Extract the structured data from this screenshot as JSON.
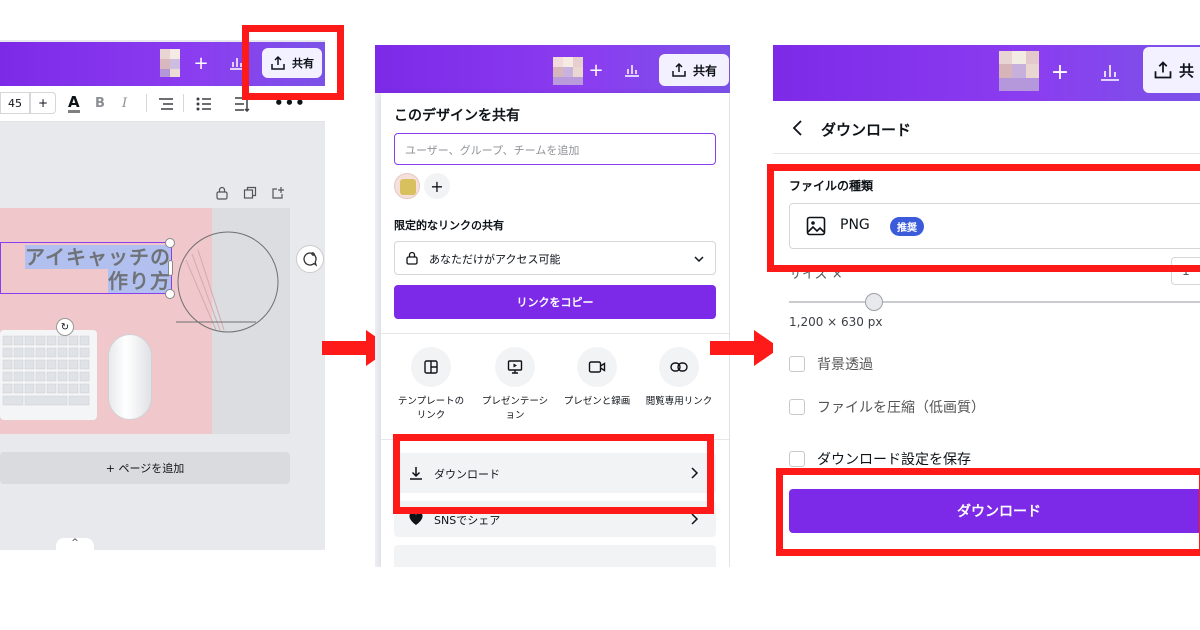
{
  "panel1": {
    "share_label": "共有",
    "font_size": "45",
    "plus": "+",
    "eyecatch_line1": "アイキャッチの",
    "eyecatch_line2": "作り方",
    "add_page": "+ ページを追加",
    "caret": "^"
  },
  "panel2": {
    "share_label": "共有",
    "title": "このデザインを共有",
    "invite_placeholder": "ユーザー、グループ、チームを追加",
    "limited_link_title": "限定的なリンクの共有",
    "access_option": "あなただけがアクセス可能",
    "copy_link": "リンクをコピー",
    "options": [
      {
        "label": "テンプレートの\nリンク",
        "icon": "template-icon"
      },
      {
        "label": "プレゼンテーシ\nョン",
        "icon": "presentation-icon"
      },
      {
        "label": "プレゼンと録画",
        "icon": "record-icon"
      },
      {
        "label": "閲覧専用リンク",
        "icon": "link-icon"
      }
    ],
    "download": "ダウンロード",
    "sns_share": "SNSでシェア"
  },
  "panel3": {
    "share_label": "共",
    "title": "ダウンロード",
    "file_type_label": "ファイルの種類",
    "file_type_value": "PNG",
    "recommended_badge": "推奨",
    "size_label": "サイズ ×",
    "size_value": "1,200 × 630 px",
    "size_partial": "1",
    "transparent_bg": "背景透過",
    "compress": "ファイルを圧縮（低画質）",
    "save_settings": "ダウンロード設定を保存",
    "download_button": "ダウンロード"
  },
  "colors": {
    "brand_purple": "#7d2ae8",
    "highlight_red": "#ff1a1a",
    "badge_blue": "#3b5bdb",
    "canvas_pink": "#f0c8cc"
  }
}
